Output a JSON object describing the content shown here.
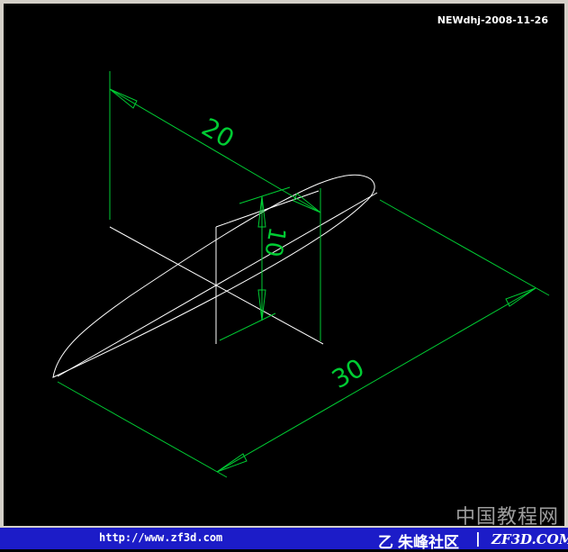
{
  "header": {
    "stamp": "NEWdhj-2008-11-26"
  },
  "drawing": {
    "dimensions": [
      {
        "label": "20"
      },
      {
        "label": "10"
      },
      {
        "label": "30"
      }
    ],
    "colors": {
      "dimension": "#00cc33",
      "geometry": "#ffffff",
      "background": "#000000"
    }
  },
  "watermark": {
    "text": "中国教程网"
  },
  "footer": {
    "url": "http://www.zf3d.com",
    "logo_icon": "zf-logo-icon",
    "logo_glyph": "乙",
    "community": "朱峰社区",
    "separator": "|",
    "domain": "ZF3D.COM",
    "background_color": "#1c1cc8"
  }
}
